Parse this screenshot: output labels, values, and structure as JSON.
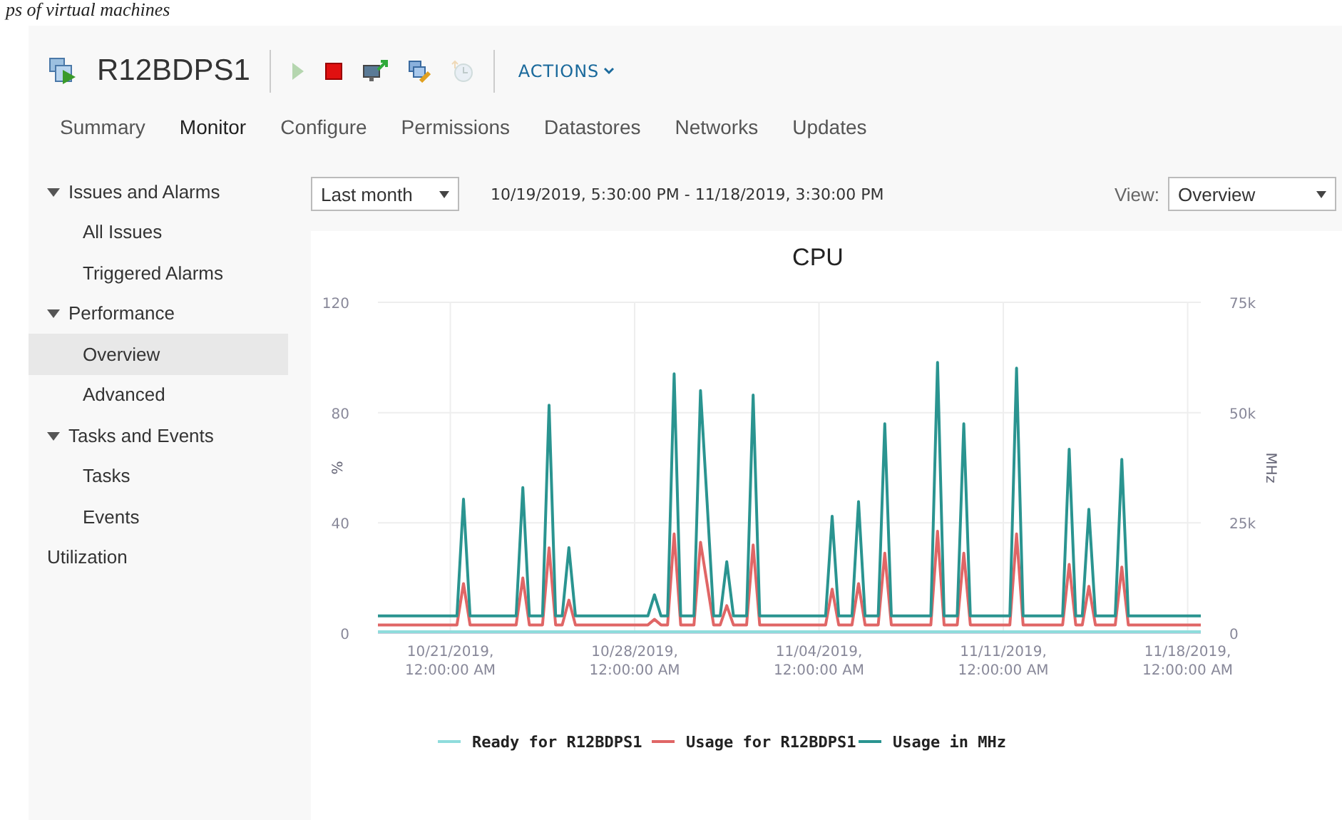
{
  "caption": "ps of virtual machines",
  "header": {
    "title": "R12BDPS1",
    "toolbar": [
      {
        "kind": "play",
        "disabled": true
      },
      {
        "kind": "stop",
        "disabled": false
      },
      {
        "kind": "console",
        "disabled": false
      },
      {
        "kind": "edit",
        "disabled": false
      },
      {
        "kind": "snapshot",
        "disabled": true
      }
    ],
    "actions": "ACTIONS"
  },
  "tabs": [
    {
      "label": "Summary",
      "selected": false
    },
    {
      "label": "Monitor",
      "selected": true
    },
    {
      "label": "Configure",
      "selected": false
    },
    {
      "label": "Permissions",
      "selected": false
    },
    {
      "label": "Datastores",
      "selected": false
    },
    {
      "label": "Networks",
      "selected": false
    },
    {
      "label": "Updates",
      "selected": false
    }
  ],
  "sidebar": {
    "items": [
      {
        "label": "Issues and Alarms",
        "expanded": true,
        "selected": false,
        "children": [
          {
            "label": "All Issues",
            "selected": false
          },
          {
            "label": "Triggered Alarms",
            "selected": false
          }
        ]
      },
      {
        "label": "Performance",
        "expanded": true,
        "selected": false,
        "children": [
          {
            "label": "Overview",
            "selected": true
          },
          {
            "label": "Advanced",
            "selected": false
          }
        ]
      },
      {
        "label": "Tasks and Events",
        "expanded": true,
        "selected": false,
        "children": [
          {
            "label": "Tasks",
            "selected": false
          },
          {
            "label": "Events",
            "selected": false
          }
        ]
      },
      {
        "label": "Utilization",
        "selected": false
      }
    ]
  },
  "controls": {
    "range": "Last month",
    "period": "10/19/2019, 5:30:00 PM - 11/18/2019, 3:30:00 PM",
    "view_label": "View:",
    "view": "Overview"
  },
  "chart": {
    "chart_data": {
      "type": "line",
      "title": "CPU",
      "legend": "bottom",
      "ylabel": "%",
      "y2label": "MHz",
      "ylim": [
        0,
        120
      ],
      "yticks": [
        0,
        40,
        80,
        120
      ],
      "y2lim": [
        0,
        75000
      ],
      "y2ticks": [
        {
          "value": 0,
          "label": "0"
        },
        {
          "value": 25000,
          "label": "25k"
        },
        {
          "value": 50000,
          "label": "50k"
        },
        {
          "value": 75000,
          "label": "75k"
        }
      ],
      "categories": [
        null,
        null,
        null,
        null,
        null,
        null,
        null,
        null,
        null,
        null,
        null,
        "10/21/2019,\n12:00:00 AM",
        null,
        null,
        null,
        null,
        null,
        null,
        null,
        null,
        null,
        null,
        null,
        null,
        null,
        null,
        null,
        null,
        null,
        null,
        null,
        null,
        null,
        null,
        null,
        null,
        null,
        null,
        null,
        "10/28/2019,\n12:00:00 AM",
        null,
        null,
        null,
        null,
        null,
        null,
        null,
        null,
        null,
        null,
        null,
        null,
        null,
        null,
        null,
        null,
        null,
        null,
        null,
        null,
        null,
        null,
        null,
        null,
        null,
        null,
        null,
        "11/04/2019,\n12:00:00 AM",
        null,
        null,
        null,
        null,
        null,
        null,
        null,
        null,
        null,
        null,
        null,
        null,
        null,
        null,
        null,
        null,
        null,
        null,
        null,
        null,
        null,
        null,
        null,
        null,
        null,
        null,
        null,
        "11/11/2019,\n12:00:00 AM",
        null,
        null,
        null,
        null,
        null,
        null,
        null,
        null,
        null,
        null,
        null,
        null,
        null,
        null,
        null,
        null,
        null,
        null,
        null,
        null,
        null,
        null,
        null,
        null,
        null,
        null,
        null,
        "11/18/2019,\n12:00:00 AM",
        null,
        null
      ],
      "series": [
        {
          "name": "Ready for R12BDPS1",
          "color": "#8fdcdc",
          "values": [
            0.5,
            0.5,
            0.5,
            0.5,
            0.5,
            0.5,
            0.5,
            0.5,
            0.5,
            0.5,
            0.5,
            0.5,
            0.5,
            0.5,
            0.5,
            0.5,
            0.5,
            0.5,
            0.5,
            0.5,
            0.5,
            0.5,
            0.5,
            0.5,
            0.5,
            0.5,
            0.5,
            0.5,
            0.5,
            0.5,
            0.5,
            0.5,
            0.5,
            0.5,
            0.5,
            0.5,
            0.5,
            0.5,
            0.5,
            0.5,
            0.5,
            0.5,
            0.5,
            0.5,
            0.5,
            0.5,
            0.5,
            0.5,
            0.5,
            0.5,
            0.5,
            0.5,
            0.5,
            0.5,
            0.5,
            0.5,
            0.5,
            0.5,
            0.5,
            0.5,
            0.5,
            0.5,
            0.5,
            0.5,
            0.5,
            0.5,
            0.5,
            0.5,
            0.5,
            0.5,
            0.5,
            0.5,
            0.5,
            0.5,
            0.5,
            0.5,
            0.5,
            0.5,
            0.5,
            0.5,
            0.5,
            0.5,
            0.5,
            0.5,
            0.5,
            0.5,
            0.5,
            0.5,
            0.5,
            0.5,
            0.5,
            0.5,
            0.5,
            0.5,
            0.5,
            0.5,
            0.5,
            0.5,
            0.5,
            0.5,
            0.5,
            0.5,
            0.5,
            0.5,
            0.5,
            0.5,
            0.5,
            0.5,
            0.5,
            0.5,
            0.5,
            0.5,
            0.5,
            0.5,
            0.5,
            0.5,
            0.5,
            0.5,
            0.5,
            0.5,
            0.5,
            0.5,
            0.5,
            0.5,
            0.5,
            0.5
          ]
        },
        {
          "name": "Usage for R12BDPS1",
          "color": "#e06666",
          "values": [
            3,
            3,
            3,
            3,
            3,
            3,
            3,
            3,
            3,
            3,
            3,
            3,
            3,
            18,
            3,
            3,
            3,
            3,
            3,
            3,
            3,
            3,
            20,
            3,
            3,
            3,
            31,
            3,
            3,
            12,
            3,
            3,
            3,
            3,
            3,
            3,
            3,
            3,
            3,
            3,
            3,
            3,
            5,
            3,
            3,
            36,
            3,
            3,
            3,
            33,
            18,
            3,
            3,
            10,
            3,
            3,
            3,
            32,
            3,
            3,
            3,
            3,
            3,
            3,
            3,
            3,
            3,
            3,
            3,
            16,
            3,
            3,
            3,
            18,
            3,
            3,
            3,
            29,
            3,
            3,
            3,
            3,
            3,
            3,
            3,
            37,
            3,
            3,
            3,
            29,
            3,
            3,
            3,
            3,
            3,
            3,
            3,
            36,
            3,
            3,
            3,
            3,
            3,
            3,
            3,
            25,
            3,
            3,
            17,
            3,
            3,
            3,
            3,
            24,
            3,
            3,
            3,
            3,
            3,
            3,
            3,
            3,
            3,
            3,
            3,
            3
          ]
        },
        {
          "name": "Usage in MHz",
          "color": "#2a9490",
          "axis": "y2",
          "values": [
            3900,
            3900,
            3900,
            3900,
            3900,
            3900,
            3900,
            3900,
            3900,
            3900,
            3900,
            3900,
            3900,
            30400,
            3900,
            3900,
            3900,
            3900,
            3900,
            3900,
            3900,
            3900,
            33000,
            3900,
            3900,
            3900,
            51700,
            3900,
            3900,
            19400,
            3900,
            3900,
            3900,
            3900,
            3900,
            3900,
            3900,
            3900,
            3900,
            3900,
            3900,
            3900,
            8700,
            3900,
            3900,
            58800,
            3900,
            3900,
            3900,
            55000,
            29800,
            3900,
            3900,
            16200,
            3900,
            3900,
            3900,
            54000,
            3900,
            3900,
            3900,
            3900,
            3900,
            3900,
            3900,
            3900,
            3900,
            3900,
            3900,
            26500,
            3900,
            3900,
            3900,
            29800,
            3900,
            3900,
            3900,
            47500,
            3900,
            3900,
            3900,
            3900,
            3900,
            3900,
            3900,
            61400,
            3900,
            3900,
            3900,
            47500,
            3900,
            3900,
            3900,
            3900,
            3900,
            3900,
            3900,
            60100,
            3900,
            3900,
            3900,
            3900,
            3900,
            3900,
            3900,
            41700,
            3900,
            3900,
            28100,
            3900,
            3900,
            3900,
            3900,
            39400,
            3900,
            3900,
            3900,
            3900,
            3900,
            3900,
            3900,
            3900,
            3900,
            3900,
            3900,
            3900
          ]
        }
      ]
    }
  }
}
